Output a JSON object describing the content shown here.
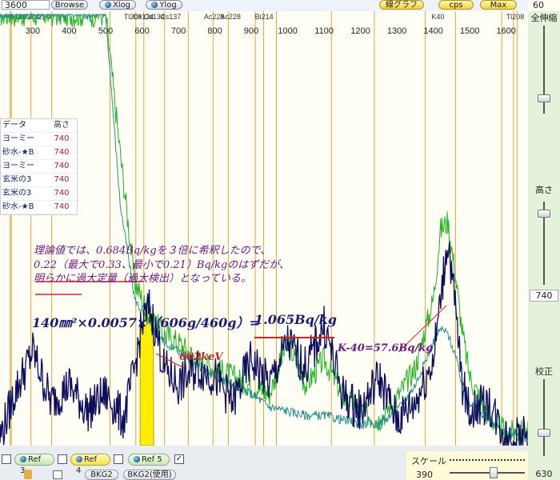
{
  "toolbar": {
    "count_value": "3600",
    "browse_label": "Browse",
    "xlog_label": "Xlog",
    "ylog_label": "Ylog",
    "line_graph_label": "線グラフ",
    "cps_label": "cps",
    "max_label": "Max",
    "right_value": "60"
  },
  "nuclide_labels": [
    "Pb212",
    "Pb214",
    "Pb214",
    "Cs134",
    "Tl208",
    "Cs134",
    "Cs137",
    "Ac228",
    "Ac228",
    "Bi214",
    "K40",
    "Tl208"
  ],
  "energy_axis": [
    "300",
    "400",
    "500",
    "600",
    "700",
    "800",
    "900",
    "1000",
    "1100",
    "1200",
    "1300",
    "1400",
    "1500",
    "1600"
  ],
  "legend": {
    "header_name": "データ",
    "header_height": "高さ",
    "rows": [
      {
        "name": "ヨーミー",
        "height": "740"
      },
      {
        "name": "砂水-★B",
        "height": "740"
      },
      {
        "name": "ヨーミー",
        "height": "740"
      },
      {
        "name": "玄米の3",
        "height": "740"
      },
      {
        "name": "玄米の3",
        "height": "740"
      },
      {
        "name": "砂水-★B",
        "height": "740"
      }
    ]
  },
  "annotation": {
    "line1": "理論値では、0.684Bq/kgを３倍に希釈したので、",
    "line2": "0.22（最大で0.33、最小で0.21）Bq/kgのはずだが、",
    "line3": "明らかに過大定量（過大検出）となっている。",
    "formula_left": "140㎜²×0.0057×（606g/460g）=",
    "formula_result": "1.065Bq/kg",
    "peak_cs": "662keV",
    "peak_k": "K-40=57.6Bq/kg"
  },
  "sidebar": {
    "zoom_label": "全伸縮",
    "height_label": "高さ",
    "height_value": "740",
    "calib_label": "校正",
    "calib_value": "630"
  },
  "bottombar": {
    "ref3_label": "Ref 3",
    "ref4_label": "Ref 4",
    "ref5_label": "Ref 5",
    "bkg2_label": "BKG2",
    "bkg2_use_label": "BKG2(使用)",
    "scale_label": "スケール",
    "scale_value": "390"
  },
  "colors": {
    "green_series": "#1fb31f",
    "teal_series": "#2a8f8f",
    "navy_series": "#0c0c5c",
    "nuclide_lines": "#e2a63a",
    "annotation_purple": "#6b1a84",
    "annotation_navy": "#1b1b7a",
    "annotation_red": "#d42020"
  },
  "chart_data": {
    "type": "line",
    "xlabel": "",
    "ylabel": "",
    "x_unit": "keV",
    "xlim": [
      210,
      1660
    ],
    "series": [
      {
        "x": [
          210,
          250,
          300,
          350,
          400,
          450,
          500,
          540,
          580,
          620,
          660,
          700,
          750,
          800,
          850,
          900,
          950,
          1000,
          1050,
          1100,
          1150,
          1200,
          1250,
          1300,
          1350,
          1400,
          1420,
          1440,
          1460,
          1480,
          1500,
          1550,
          1600,
          1650
        ],
        "y": [
          100,
          100,
          100,
          100,
          100,
          100,
          100,
          68,
          38,
          30,
          26,
          24,
          20,
          18,
          16,
          14,
          12,
          24,
          14,
          20,
          12,
          8,
          6,
          11,
          18,
          34,
          50,
          52,
          40,
          26,
          16,
          7,
          3,
          3
        ]
      },
      {
        "x": [
          210,
          250,
          300,
          350,
          400,
          450,
          500,
          540,
          580,
          620,
          660,
          700,
          750,
          800,
          850,
          900,
          950,
          1000,
          1050,
          1100,
          1150,
          1200,
          1250,
          1300,
          1350,
          1400,
          1420,
          1440,
          1460,
          1480,
          1500,
          1550,
          1600,
          1650
        ],
        "y": [
          100,
          100,
          100,
          100,
          100,
          100,
          100,
          56,
          34,
          28,
          24,
          22,
          19,
          16,
          14,
          12,
          9,
          8,
          7,
          7,
          6,
          5,
          5,
          8,
          14,
          24,
          27,
          26,
          21,
          14,
          10,
          6,
          3,
          3
        ]
      },
      {
        "x": [
          210,
          250,
          300,
          350,
          400,
          450,
          500,
          550,
          580,
          600,
          620,
          640,
          660,
          700,
          750,
          800,
          850,
          900,
          950,
          1000,
          1050,
          1100,
          1150,
          1200,
          1250,
          1300,
          1350,
          1400,
          1420,
          1440,
          1460,
          1480,
          1500,
          1550,
          1600,
          1650
        ],
        "y": [
          2,
          12,
          22,
          10,
          14,
          8,
          12,
          6,
          18,
          28,
          32,
          26,
          18,
          14,
          18,
          16,
          10,
          20,
          14,
          24,
          18,
          28,
          12,
          8,
          16,
          6,
          10,
          20,
          34,
          48,
          32,
          14,
          8,
          10,
          2,
          2
        ]
      }
    ]
  }
}
